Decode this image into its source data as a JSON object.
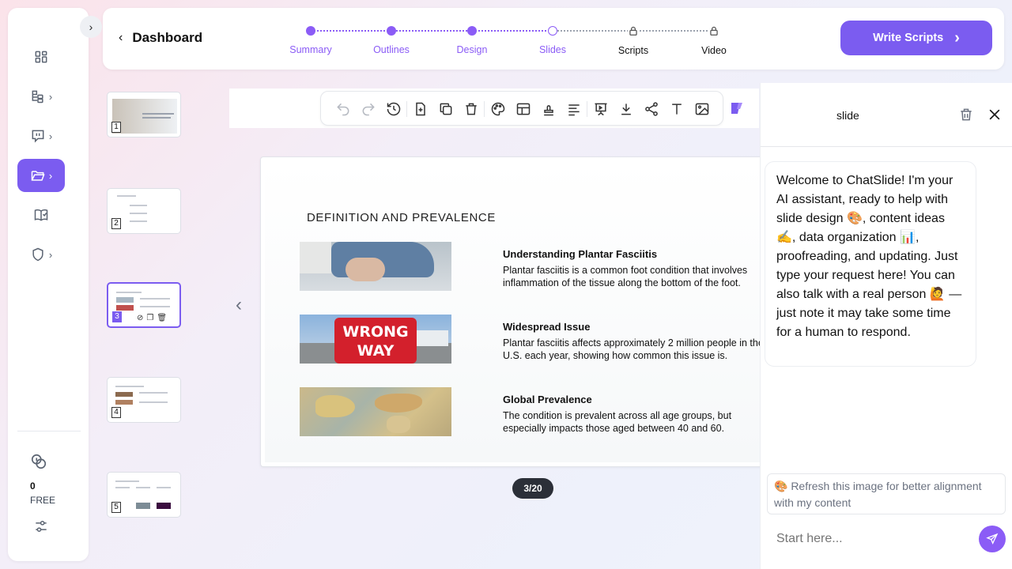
{
  "header": {
    "back_label": "Dashboard",
    "steps": [
      {
        "label": "Summary",
        "state": "done"
      },
      {
        "label": "Outlines",
        "state": "done"
      },
      {
        "label": "Design",
        "state": "done"
      },
      {
        "label": "Slides",
        "state": "current"
      },
      {
        "label": "Scripts",
        "state": "locked"
      },
      {
        "label": "Video",
        "state": "locked"
      }
    ],
    "cta_label": "Write Scripts"
  },
  "sidebar": {
    "items": [
      {
        "icon": "dashboard-grid-icon"
      },
      {
        "icon": "sitemap-icon"
      },
      {
        "icon": "chat-bubble-icon"
      },
      {
        "icon": "folder-open-icon",
        "active": true
      },
      {
        "icon": "book-check-icon"
      },
      {
        "icon": "shield-icon"
      }
    ],
    "credits": "0",
    "plan": "FREE"
  },
  "thumbnails": [
    {
      "number": "1"
    },
    {
      "number": "2"
    },
    {
      "number": "3",
      "active": true
    },
    {
      "number": "4"
    },
    {
      "number": "5"
    }
  ],
  "slide": {
    "title": "DEFINITION AND PREVALENCE",
    "sections": [
      {
        "heading": "Understanding Plantar Fasciitis",
        "body": "Plantar fasciitis is a common foot condition that involves inflammation of the tissue along the bottom of the foot."
      },
      {
        "heading": "Widespread Issue",
        "body": "Plantar fasciitis affects approximately 2 million people in the U.S. each year, showing how common this issue is."
      },
      {
        "heading": "Global Prevalence",
        "body": "The condition is prevalent across all age groups, but especially impacts those aged between 40 and 60."
      }
    ],
    "sign_text_1": "WRONG",
    "sign_text_2": "WAY",
    "pager": "3/20"
  },
  "chat": {
    "title": "slide",
    "welcome": "Welcome to ChatSlide! I'm your AI assistant, ready to help with slide design 🎨, content ideas ✍️, data organization 📊, proofreading, and updating. Just type your request here! You can also talk with a real person 🙋 — just note it may take some time for a human to respond.",
    "suggestion": "🎨 Refresh this image for better alignment with my content",
    "input_placeholder": "Start here..."
  },
  "colors": {
    "accent": "#7b5cf0",
    "pager_bg": "#2b2f38"
  }
}
